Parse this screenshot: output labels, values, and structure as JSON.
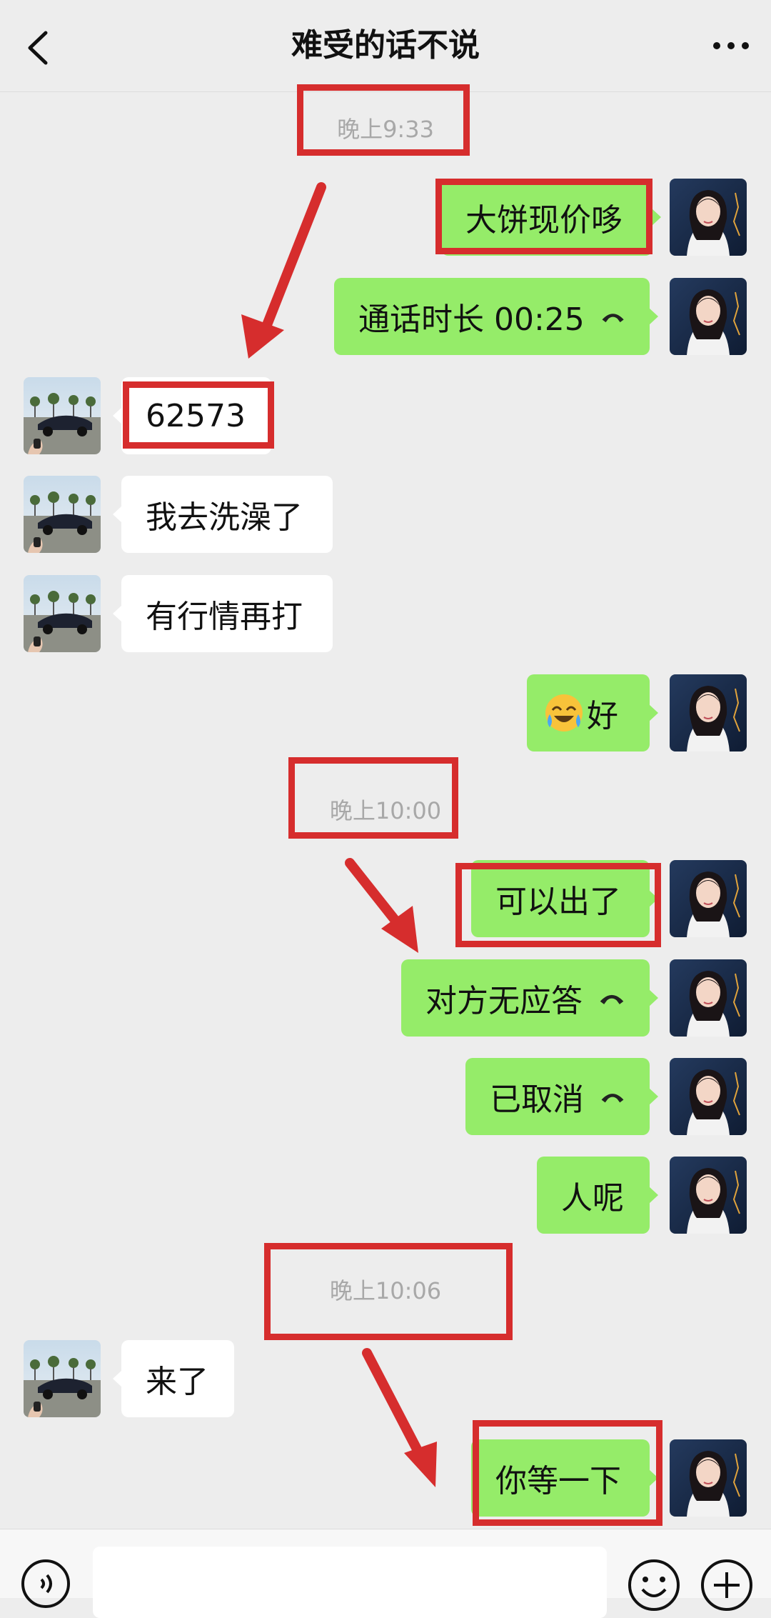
{
  "header": {
    "title": "难受的话不说"
  },
  "messages": [
    {
      "type": "time",
      "text": "晚上9:33"
    },
    {
      "type": "msg",
      "side": "right",
      "text": "大饼现价哆"
    },
    {
      "type": "msg",
      "side": "right",
      "text": "通话时长  00:25",
      "icon": "phone-hangup-icon"
    },
    {
      "type": "msg",
      "side": "left",
      "text": "62573"
    },
    {
      "type": "msg",
      "side": "left",
      "text": "我去洗澡了"
    },
    {
      "type": "msg",
      "side": "left",
      "text": "有行情再打"
    },
    {
      "type": "msg",
      "side": "right",
      "text": "好",
      "icon": "crying-laughing-emoji"
    },
    {
      "type": "time",
      "text": "晚上10:00"
    },
    {
      "type": "msg",
      "side": "right",
      "text": "可以出了"
    },
    {
      "type": "msg",
      "side": "right",
      "text": "对方无应答",
      "icon": "phone-hangup-icon"
    },
    {
      "type": "msg",
      "side": "right",
      "text": "已取消",
      "icon": "phone-hangup-icon"
    },
    {
      "type": "msg",
      "side": "right",
      "text": "人呢"
    },
    {
      "type": "time",
      "text": "晚上10:06"
    },
    {
      "type": "msg",
      "side": "left",
      "text": "来了"
    },
    {
      "type": "msg",
      "side": "right",
      "text": "你等一下"
    }
  ],
  "colors": {
    "sent_bubble": "#95ec69",
    "received_bubble": "#ffffff",
    "annotation": "#d62d2d",
    "background": "#ededed"
  },
  "icons": {
    "back": "chevron-left-icon",
    "more": "more-dots-icon",
    "voice": "voice-input-icon",
    "emoji": "emoji-icon",
    "plus": "plus-icon"
  }
}
